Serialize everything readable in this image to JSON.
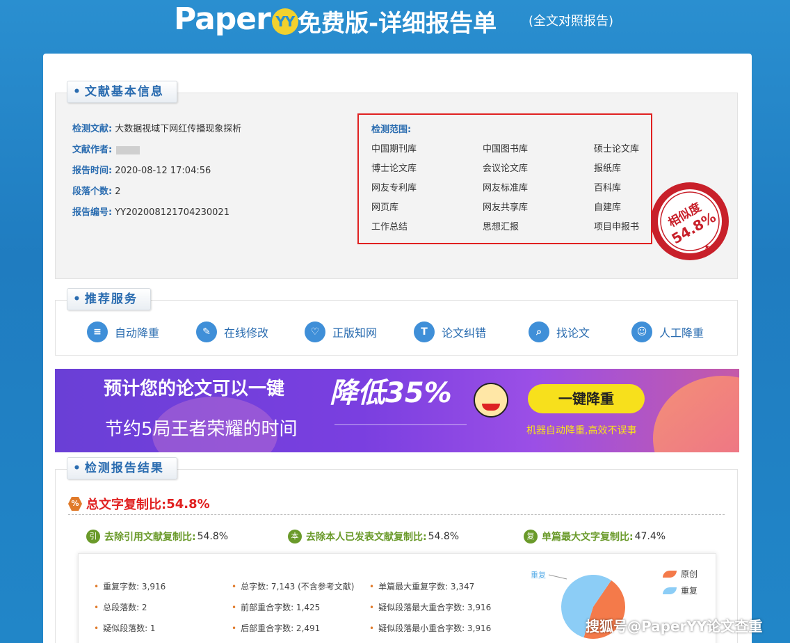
{
  "header": {
    "logo_text": "Paper",
    "logo_badge": "YY",
    "title": "免费版-详细报告单",
    "subtitle": "(全文对照报告)"
  },
  "info": {
    "tab_label": "文献基本信息",
    "rows": [
      {
        "label": "检测文献:",
        "value": "大数据视域下网红传播现象探析"
      },
      {
        "label": "文献作者:",
        "value": ""
      },
      {
        "label": "报告时间:",
        "value": "2020-08-12 17:04:56"
      },
      {
        "label": "段落个数:",
        "value": "2"
      },
      {
        "label": "报告编号:",
        "value": "YY202008121704230021"
      }
    ],
    "scope_title": "检测范围:",
    "scope_items": [
      "中国期刊库",
      "中国图书库",
      "硕士论文库",
      "博士论文库",
      "会议论文库",
      "报纸库",
      "网友专利库",
      "网友标准库",
      "百科库",
      "网页库",
      "网友共享库",
      "自建库",
      "工作总结",
      "思想汇报",
      "项目申报书"
    ],
    "stamp_label": "相似度",
    "stamp_value": "54.8%"
  },
  "services": {
    "tab_label": "推荐服务",
    "items": [
      {
        "label": "自动降重",
        "icon": "sort-icon"
      },
      {
        "label": "在线修改",
        "icon": "pencil-icon"
      },
      {
        "label": "正版知网",
        "icon": "heart-icon"
      },
      {
        "label": "论文纠错",
        "icon": "text-icon"
      },
      {
        "label": "找论文",
        "icon": "search-icon"
      },
      {
        "label": "人工降重",
        "icon": "users-icon"
      }
    ]
  },
  "banner": {
    "headline": "预计您的论文可以一键",
    "highlight": "降低35%",
    "subline": "节约5局王者荣耀的时间",
    "button": "一键降重",
    "note": "机器自动降重,高效不误事"
  },
  "results": {
    "tab_label": "检测报告结果",
    "total_label": "总文字复制比:",
    "total_value": "54.8%",
    "stats": [
      {
        "icon_text": "引",
        "label": "去除引用文献复制比:",
        "value": "54.8%"
      },
      {
        "icon_text": "本",
        "label": "去除本人已发表文献复制比:",
        "value": "54.8%"
      },
      {
        "icon_text": "复",
        "label": "单篇最大文字复制比:",
        "value": "47.4%"
      }
    ],
    "details": [
      "重复字数: 3,916",
      "总字数: 7,143 (不含参考文献)",
      "单篇最大重复字数: 3,347",
      "总段落数: 2",
      "前部重合字数: 1,425",
      "疑似段落最大重合字数: 3,916",
      "疑似段落数: 1",
      "后部重合字数: 2,491",
      "疑似段落最小重合字数: 3,916"
    ]
  },
  "chart_data": {
    "type": "pie",
    "categories": [
      "原创",
      "重复"
    ],
    "values": [
      45.2,
      54.8
    ],
    "colors": [
      "#f47a4a",
      "#8ccdf6"
    ],
    "legend": [
      "原创",
      "重复"
    ],
    "legend_position": "right"
  },
  "watermark": "搜狐号@PaperYY论文查重",
  "colors": {
    "accent": "#2a6cb0",
    "alert": "#e02020",
    "green": "#6a9a2a"
  }
}
